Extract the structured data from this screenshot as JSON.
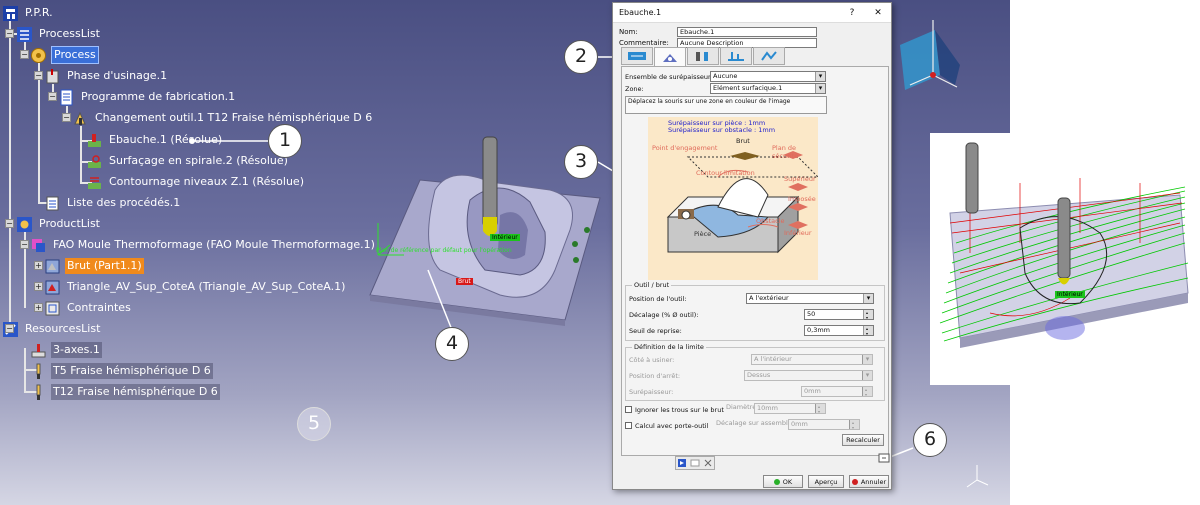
{
  "tree": {
    "root": "P.P.R.",
    "process_list": "ProcessList",
    "process": "Process",
    "phase": "Phase d'usinage.1",
    "programme": "Programme de fabrication.1",
    "tool_change": "Changement outil.1  T12 Fraise hémisphérique D 6",
    "op_ebauche": "Ebauche.1 (Résolue)",
    "op_surfacage": "Surfaçage en spirale.2 (Résolue)",
    "op_contournage": "Contournage niveaux Z.1 (Résolue)",
    "proc_list": "Liste des procédés.1",
    "product_list": "ProductList",
    "fao": "FAO Moule Thermoformage (FAO Moule Thermoformage.1)",
    "brut": "Brut (Part1.1)",
    "triangle": "Triangle_AV_Sup_CoteA (Triangle_AV_Sup_CoteA.1)",
    "contraintes": "Contraintes",
    "resources_list": "ResourcesList",
    "machine": "3-axes.1",
    "tool_t5": "T5 Fraise hémisphérique D 6",
    "tool_t12": "T12 Fraise hémisphérique D 6"
  },
  "callouts": [
    "1",
    "2",
    "3",
    "4",
    "5",
    "6"
  ],
  "scene": {
    "tag_interieur": "Intérieur",
    "tag_brut": "Brut",
    "tag_interieur2": "Intérieur",
    "ref_text": "Plan de référence par défaut pour l'opération"
  },
  "dialog": {
    "title": "Ebauche.1",
    "help": "?",
    "close": "✕",
    "nom_label": "Nom:",
    "nom_value": "Ebauche.1",
    "comment_label": "Commentaire:",
    "comment_value": "Aucune Description",
    "ensemble_label": "Ensemble de surépaisseurs:",
    "ensemble_value": "Aucune",
    "zone_label": "Zone:",
    "zone_value": "Elément surfacique.1",
    "hint": "Déplacez la souris sur une zone en couleur de l'image",
    "diagram": {
      "sur_piece": "Surépaisseur sur pièce : 1mm",
      "sur_obstacle": "Surépaisseur sur obstacle : 1mm",
      "brut": "Brut",
      "point_engagement": "Point d'engagement",
      "plan_securite": "Plan de sécurité",
      "contour_limitation": "Contour limitation",
      "superieur": "Supérieur",
      "imposee": "Imposée",
      "obstacle": "Obstacle",
      "piece": "Pièce",
      "inferieur": "Inférieur"
    },
    "outil_group": "Outil / brut",
    "position_label": "Position de l'outil:",
    "position_value": "A l'extérieur",
    "decalage_label": "Décalage (% Ø outil):",
    "decalage_value": "50",
    "seuil_label": "Seuil de reprise:",
    "seuil_value": "0,3mm",
    "limite_group": "Définition de la limite",
    "cote_label": "Côté à usiner:",
    "cote_value": "A l'intérieur",
    "arret_label": "Position d'arrêt:",
    "arret_value": "Dessus",
    "surep_label": "Surépaisseur:",
    "surep_value": "0mm",
    "ignorer_label": "Ignorer les trous sur le brut",
    "diametre_label": "Diamètre:",
    "diametre_value": "10mm",
    "calcul_label": "Calcul avec porte-outil",
    "decal_assemb_label": "Décalage sur assemblage:",
    "decal_assemb_value": "0mm",
    "recalculer": "Recalculer",
    "ok": "OK",
    "apercu": "Aperçu",
    "annuler": "Annuler"
  },
  "colors": {
    "selected_blue": "#3a6fd8",
    "selected_orange": "#f08a1c",
    "toolpath_green": "#00c800",
    "toolpath_red": "#e00000"
  }
}
